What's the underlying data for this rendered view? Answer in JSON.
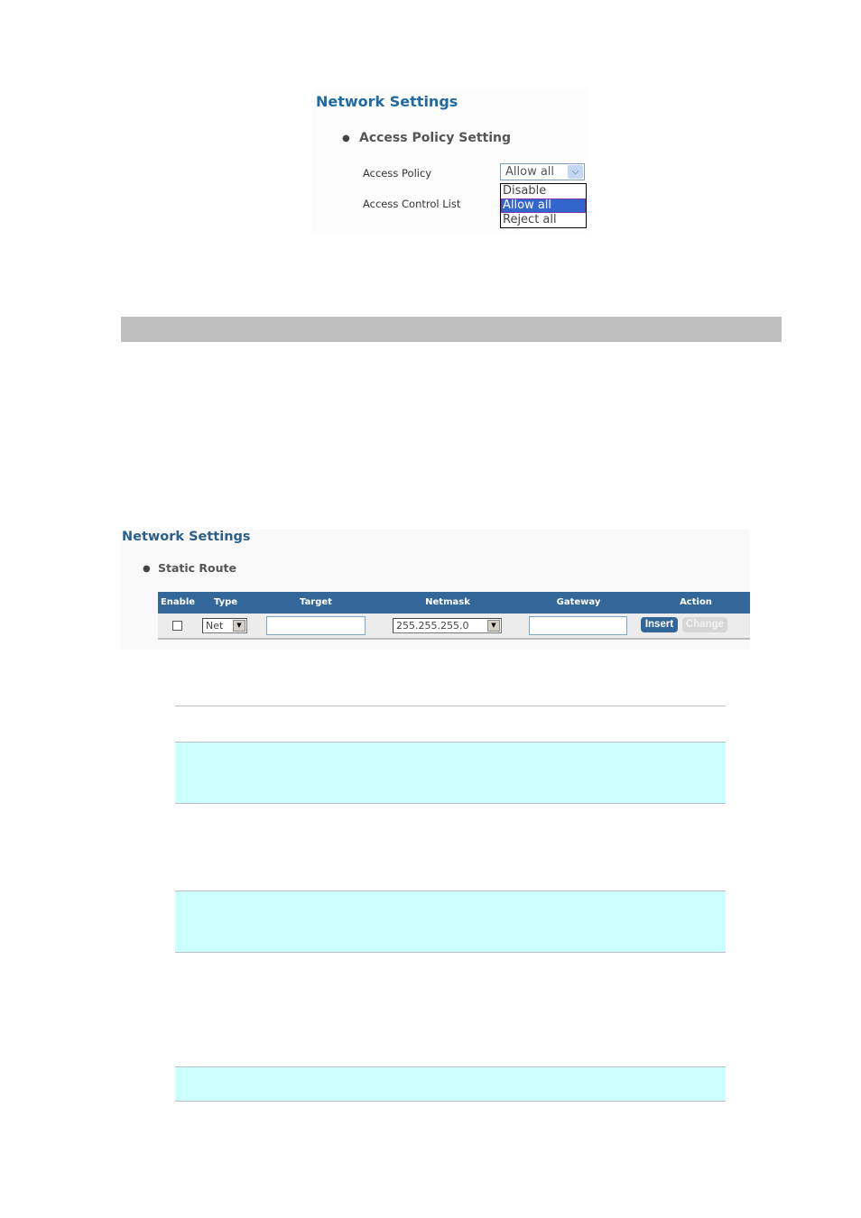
{
  "access_policy_panel": {
    "title": "Network Settings",
    "section": "Access Policy Setting",
    "fields": {
      "access_policy_label": "Access Policy",
      "access_control_list_label": "Access Control List"
    },
    "access_policy_select": {
      "selected": "Allow all",
      "options": [
        "Disable",
        "Allow all",
        "Reject all"
      ],
      "highlighted_option": "Allow all"
    },
    "icons": {
      "dropdown": "chevron-down-icon"
    }
  },
  "static_route_panel": {
    "title": "Network Settings",
    "section": "Static Route",
    "columns": [
      "Enable",
      "Type",
      "Target",
      "Netmask",
      "Gateway",
      "Action"
    ],
    "row": {
      "enable_checked": false,
      "type_value": "Net",
      "target_value": "",
      "netmask_value": "255.255.255.0",
      "gateway_value": "",
      "insert_label": "Insert",
      "change_label": "Change"
    },
    "colors": {
      "header_bg": "#336699",
      "row_bg": "#ececec",
      "insert_bg": "#336699",
      "change_bg": "#d6d6d6"
    }
  },
  "colors": {
    "title_blue": "#1f6aa5",
    "gray_bar": "#bfbfbf",
    "cyan_row": "#ccffff",
    "rule": "#bdbdc4"
  }
}
